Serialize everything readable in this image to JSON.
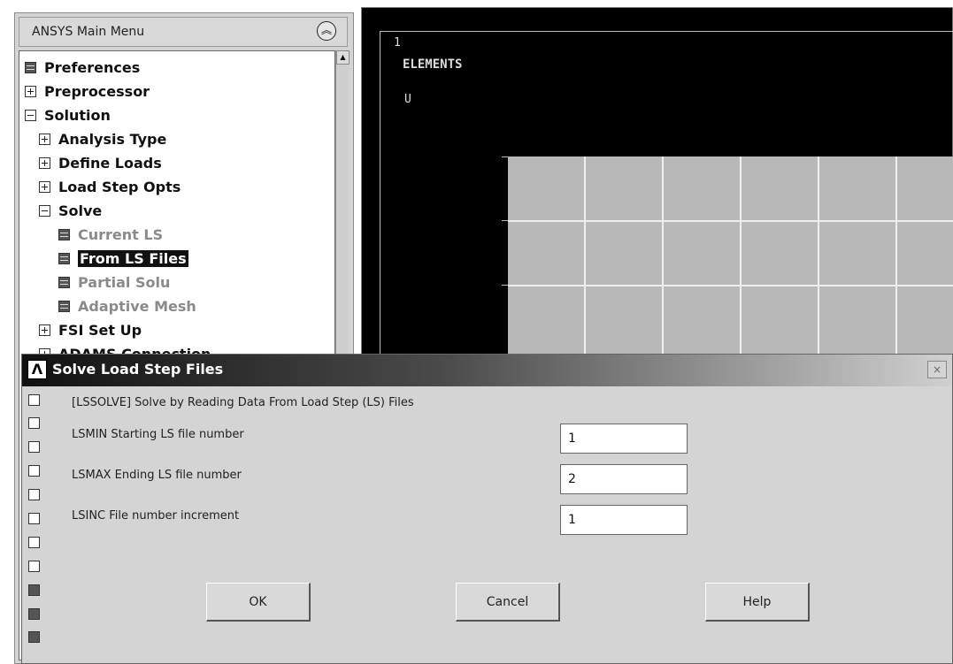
{
  "main_menu": {
    "title": "ANSYS Main Menu",
    "items": [
      {
        "label": "Preferences",
        "icon": "doc"
      },
      {
        "label": "Preprocessor",
        "icon": "plus"
      },
      {
        "label": "Solution",
        "icon": "minus"
      },
      {
        "label": "Analysis Type",
        "icon": "plus"
      },
      {
        "label": "Define Loads",
        "icon": "plus"
      },
      {
        "label": "Load Step Opts",
        "icon": "plus"
      },
      {
        "label": "Solve",
        "icon": "minus"
      },
      {
        "label": "Current LS",
        "icon": "doc",
        "state": "dim"
      },
      {
        "label": "From LS Files",
        "icon": "doc",
        "state": "selected"
      },
      {
        "label": "Partial Solu",
        "icon": "doc",
        "state": "dim"
      },
      {
        "label": "Adaptive Mesh",
        "icon": "doc",
        "state": "dim"
      },
      {
        "label": "FSI Set Up",
        "icon": "plus"
      },
      {
        "label": "ADAMS Connection",
        "icon": "plus"
      }
    ]
  },
  "graphics": {
    "window_number": "1",
    "title": "ELEMENTS",
    "symbol": "U"
  },
  "dialog": {
    "title": "Solve Load Step Files",
    "description": "[LSSOLVE]  Solve by Reading Data From Load Step (LS) Files",
    "fields": [
      {
        "label": "LSMIN  Starting LS file number",
        "value": "1"
      },
      {
        "label": "LSMAX  Ending LS file number",
        "value": "2"
      },
      {
        "label": "LSINC  File number increment",
        "value": "1"
      }
    ],
    "buttons": {
      "ok": "OK",
      "cancel": "Cancel",
      "help": "Help"
    },
    "close_glyph": "×"
  }
}
